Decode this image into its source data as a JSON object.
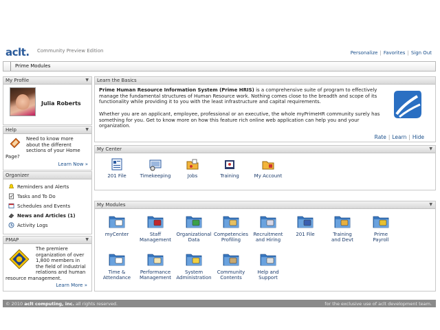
{
  "header": {
    "logo": "aclt.",
    "edition": "Community Preview Edition",
    "links": [
      "Personalize",
      "Favorites",
      "Sign Out"
    ]
  },
  "nav": {
    "tab": "Prime Modules"
  },
  "profile": {
    "title": "My Profile",
    "name": "Julia Roberts"
  },
  "help": {
    "title": "Help",
    "line1": "Need to know more",
    "line2": "about the different",
    "line3": "sections of your Home",
    "line4": "Page?",
    "more": "Learn Now »"
  },
  "organizer": {
    "title": "Organizer",
    "items": [
      "Reminders and Alerts",
      "Tasks and To Do",
      "Schedules and Events",
      "News and Articles (1)",
      "Activity Logs"
    ]
  },
  "pmap": {
    "title": "PMAP",
    "line1": "The premiere",
    "line2": "organization of over",
    "line3": "1,800 members in",
    "line4": "the field of industrial",
    "line5": "relations and human",
    "line6": "resource management.",
    "more": "Learn More »"
  },
  "basics": {
    "title": "Learn the Basics",
    "heading": "Prime Human Resource Information System (Prime HRIS)",
    "p1_rest": " is a comprehensive suite of program to effectively manage the fundamental structures of Human Resource work. Nothing comes close to the breadth and scope of its functionality while providing it to you with the least infrastructure and capital requirements.",
    "p2": "Whether you are an applicant, employee, professional or an executive, the whole myPrimeHR community surely has something for you. Get to know more on how this feature rich online web application can help you and your organization.",
    "links": [
      "Rate",
      "Learn",
      "Hide"
    ]
  },
  "center": {
    "title": "My Center",
    "items": [
      "201 File",
      "Timekeeping",
      "Jobs",
      "Training",
      "My Account"
    ]
  },
  "modules": {
    "title": "My Modules",
    "row1": [
      {
        "l1": "myCenter",
        "l2": ""
      },
      {
        "l1": "Staff",
        "l2": "Management"
      },
      {
        "l1": "Organizational",
        "l2": "Data"
      },
      {
        "l1": "Competencies",
        "l2": "Profiling"
      },
      {
        "l1": "Recruitment",
        "l2": "and Hiring"
      },
      {
        "l1": "201 File",
        "l2": ""
      },
      {
        "l1": "Training",
        "l2": "and Devt"
      },
      {
        "l1": "Prime",
        "l2": "Payroll"
      }
    ],
    "row2": [
      {
        "l1": "Time &",
        "l2": "Attendance"
      },
      {
        "l1": "Performance",
        "l2": "Management"
      },
      {
        "l1": "System",
        "l2": "Administration"
      },
      {
        "l1": "Community",
        "l2": "Contents"
      },
      {
        "l1": "Help and",
        "l2": "Support"
      }
    ]
  },
  "footer": {
    "left_pre": "© 2010 ",
    "left_bold": "aclt computing, inc.",
    "left_post": " all rights reserved.",
    "right": "for the exclusive use of aclt development team."
  },
  "colors": {
    "link": "#1a4f8b",
    "footer": "#8a8a8a",
    "panel_header": "#dcdcdc",
    "folder": "#3a78c0"
  }
}
